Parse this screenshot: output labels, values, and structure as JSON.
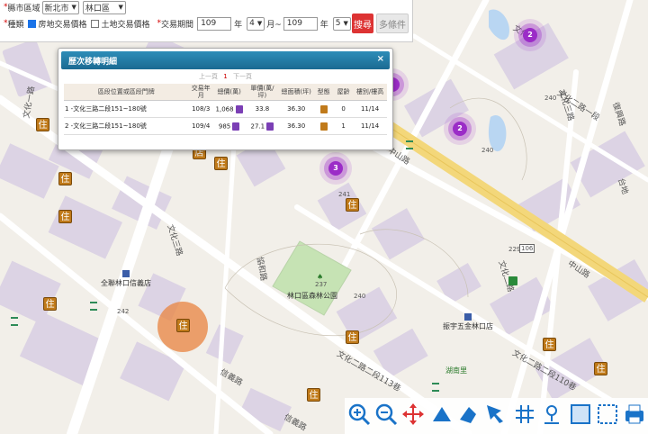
{
  "filter": {
    "region_label": "縣市區域",
    "city": "新北市",
    "district": "林口區",
    "type_label": "種類",
    "opt_house": "房地交易價格",
    "opt_land": "土地交易價格",
    "period_label": "交易期間",
    "from_year": "109",
    "year_unit": "年",
    "from_month": "4",
    "month_sep": "月~",
    "to_year": "109",
    "to_month": "5",
    "month_unit": "月",
    "search_btn": "搜尋",
    "multi_btn": "多條件"
  },
  "popup": {
    "title": "歷次移轉明細",
    "close": "×",
    "pager_prev": "上一頁",
    "pager_cur": "1",
    "pager_next": "下一頁",
    "columns": [
      "區段位置或區段門牌",
      "交易年月",
      "總價(萬)",
      "單價(萬/坪)",
      "總面積(坪)",
      "型態",
      "屋齡",
      "樓別/樓高"
    ],
    "rows": [
      {
        "addr": "1  -文化三路二段151~180號",
        "ym": "108/3",
        "total": "1,068",
        "unit": "33.8",
        "area": "36.30",
        "age": "0",
        "floor": "11/14"
      },
      {
        "addr": "2  -文化三路二段151~180號",
        "ym": "109/4",
        "total": "985",
        "unit": "27.1",
        "area": "36.30",
        "age": "1",
        "floor": "11/14"
      }
    ]
  },
  "map": {
    "roads": [
      {
        "id": "rd-wenhua1",
        "text": "文化一路"
      },
      {
        "id": "rd-zhongshan-top",
        "text": "中山路"
      },
      {
        "id": "rd-zhongshan-right",
        "text": "中山路"
      },
      {
        "id": "rd-wenhua3-left",
        "text": "文化三路"
      },
      {
        "id": "rd-wenhua2-right",
        "text": "文化二路一段"
      },
      {
        "id": "rd-wenhua2-mid",
        "text": "文化二路"
      },
      {
        "id": "rd-xinyi",
        "text": "信義路"
      },
      {
        "id": "rd-xinyi2",
        "text": "信義路"
      },
      {
        "id": "rd-wenhua2-113",
        "text": "文化二路二段113巷"
      },
      {
        "id": "rd-wenhua2-110",
        "text": "文化二路二段110巷"
      },
      {
        "id": "rd-wenhua3-right",
        "text": "文化三路"
      },
      {
        "id": "rd-tiaoheli",
        "text": "協和路"
      },
      {
        "id": "rd-taiyuan",
        "text": "台地"
      },
      {
        "id": "rd-fuxing",
        "text": "復興路"
      },
      {
        "id": "rd-wenhua1-top",
        "text": "文化"
      }
    ],
    "pois": [
      {
        "id": "poi-bank",
        "text": "全聯林口信義店"
      },
      {
        "id": "poi-park",
        "text": "林口區森林公園"
      },
      {
        "id": "poi-store",
        "text": "振宇五金林口店"
      },
      {
        "id": "poi-lake",
        "text": "湖南里"
      }
    ],
    "elevations": [
      "242",
      "237",
      "241",
      "240",
      "240",
      "240",
      "229",
      "106"
    ],
    "clusters": [
      "2",
      "2",
      "3"
    ],
    "marker_text": "住",
    "store_text": "店"
  },
  "toolbar": {
    "tools": [
      "zoom-in-icon",
      "zoom-out-icon",
      "pan-icon",
      "measure-distance-icon",
      "measure-area-icon",
      "select-icon",
      "grid-icon",
      "locate-icon",
      "frame-icon",
      "fullscreen-icon",
      "print-icon"
    ]
  },
  "colors": {
    "accent": "#1b6a92",
    "search": "#dd3333",
    "cluster": "#9b2cc7",
    "marker": "#c07a1a",
    "highlight": "#e8894a"
  }
}
